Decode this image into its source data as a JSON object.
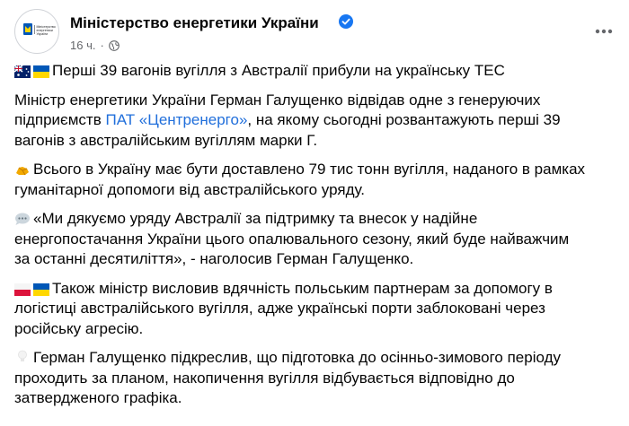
{
  "post": {
    "author": "Міністерство енергетики України",
    "avatar_text": [
      "Міністерство",
      "енергетики",
      "України"
    ],
    "time": "16 ч.",
    "dot": "·"
  },
  "paragraphs": {
    "p1": {
      "text": "Перші 39 вагонів вугілля з Австралії прибули на українську ТЕС"
    },
    "p2": {
      "line1_before": "Міністр енергетики України Герман Галущенко відвідав одне з генеруючих",
      "line2_before": "підприємств ",
      "link": "ПАТ «Центренерго»",
      "line2_after": ", на якому сьогодні розвантажують перші 39",
      "line3": "вагонів з австралійським вугіллям марки Г."
    },
    "p3": {
      "line1": "Всього в Україну має бути доставлено 79 тис тонн вугілля, наданого в рамках",
      "line2": "гуманітарної допомоги від австралійського уряду."
    },
    "p4": {
      "line1": "«Ми дякуємо уряду Австралії за підтримку та внесок у надійне",
      "line2": "енергопостачання України цього опалювального сезону, який буде найважчим",
      "line3": "за останні десятиліття», - наголосив Герман Галущенко."
    },
    "p5": {
      "line1": "Також міністр висловив вдячність польським партнерам за допомогу в",
      "line2": "логістиці австралійського вугілля, адже українські порти заблоковані через",
      "line3": "російську агресію."
    },
    "p6": {
      "line1": "Герман Галущенко підкреслив, що підготовка до осінньо-зимового періоду",
      "line2": "проходить за планом, накопичення вугілля відбувається відповідно до",
      "line3": "затвердженого графіка."
    }
  },
  "colors": {
    "link": "#216fdb",
    "verified": "#1877f2",
    "secondary_text": "#65676b",
    "ua_blue": "#0057b7",
    "ua_yellow": "#ffd700",
    "pl_red": "#dc143c"
  },
  "icons": {
    "flag_au": "australia-flag-icon",
    "flag_ua": "ukraine-flag-icon",
    "flag_pl": "poland-flag-icon",
    "coal": "coal-icon",
    "speech": "speech-bubble-icon",
    "bulb": "light-bulb-icon",
    "verified": "verified-badge-icon",
    "globe": "globe-icon",
    "more": "more-options-icon"
  }
}
